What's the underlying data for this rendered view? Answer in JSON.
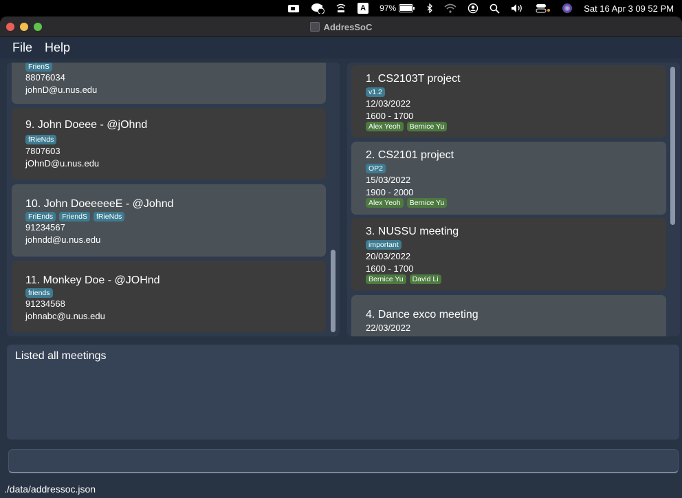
{
  "menubar": {
    "battery_pct": "97%",
    "clock": "Sat 16 Apr  3 09 52 PM",
    "badge_count": "2",
    "input_source": "A"
  },
  "window": {
    "title": "AddresSoC"
  },
  "menu": {
    "file": "File",
    "help": "Help"
  },
  "persons": [
    {
      "title": "",
      "tags": [
        "FrienS"
      ],
      "phone": "88076034",
      "email": "johnD@u.nus.edu"
    },
    {
      "title": "9.  John Doeee - @jOhnd",
      "tags": [
        "fRieNds"
      ],
      "phone": "7807603",
      "email": "jOhnD@u.nus.edu"
    },
    {
      "title": "10.  John DoeeeeeE - @Johnd",
      "tags": [
        "FriEnds",
        "FriendS",
        "fRieNds"
      ],
      "phone": "91234567",
      "email": "johndd@u.nus.edu"
    },
    {
      "title": "11.  Monkey Doe - @JOHnd",
      "tags": [
        "friends"
      ],
      "phone": "91234568",
      "email": "johnabc@u.nus.edu"
    }
  ],
  "meetings": [
    {
      "title": "1.  CS2103T project",
      "tags": [
        "v1.2"
      ],
      "date": "12/03/2022",
      "time": "1600 - 1700",
      "people": [
        "Alex Yeoh",
        "Bernice Yu"
      ]
    },
    {
      "title": "2.  CS2101 project",
      "tags": [
        "OP2"
      ],
      "date": "15/03/2022",
      "time": "1900 - 2000",
      "people": [
        "Alex Yeoh",
        "Bernice Yu"
      ]
    },
    {
      "title": "3.  NUSSU meeting",
      "tags": [
        "important"
      ],
      "date": "20/03/2022",
      "time": "1600 - 1700",
      "people": [
        "Bernice Yu",
        "David Li"
      ]
    },
    {
      "title": "4.  Dance exco meeting",
      "tags": [],
      "date": "22/03/2022",
      "time": "",
      "people": []
    }
  ],
  "result": {
    "text": "Listed all meetings"
  },
  "command": {
    "value": "",
    "placeholder": ""
  },
  "status": {
    "path": "./data/addressoc.json"
  },
  "colors": {
    "window_bg": "#283444",
    "card": "#4b5257",
    "card_dark": "#3c3c3c",
    "tag_blue": "#3e7b91",
    "tag_green": "#4c7a3f"
  }
}
